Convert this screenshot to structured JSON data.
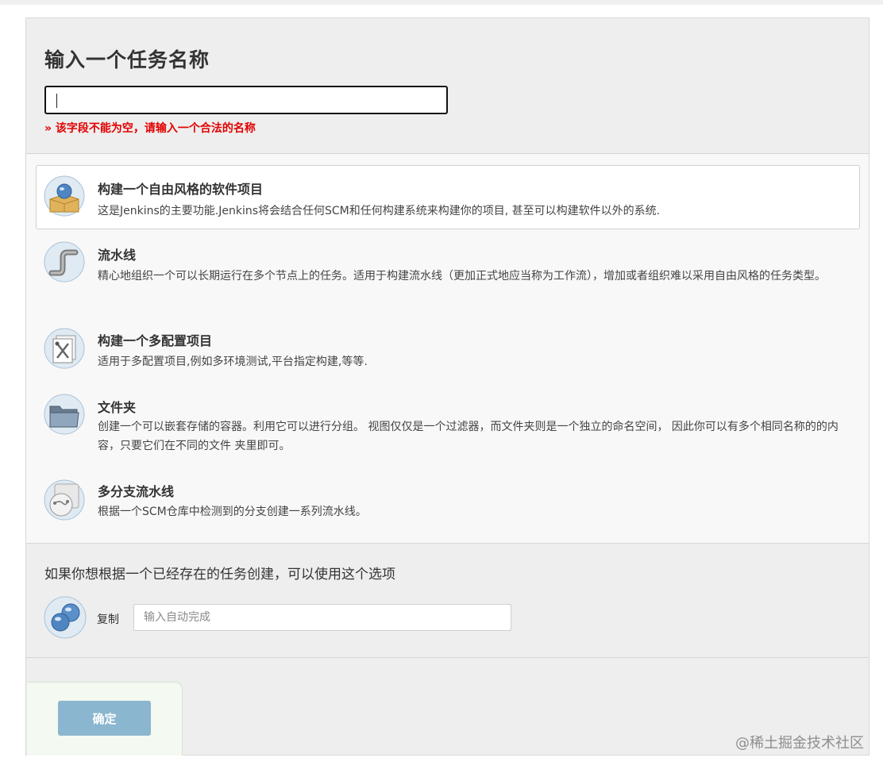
{
  "form": {
    "heading": "输入一个任务名称",
    "name_value": "",
    "error": "» 该字段不能为空，请输入一个合法的名称"
  },
  "types": [
    {
      "icon": "freestyle-project-icon",
      "title": "构建一个自由风格的软件项目",
      "description": "这是Jenkins的主要功能.Jenkins将会结合任何SCM和任何构建系统来构建你的项目, 甚至可以构建软件以外的系统.",
      "selected": true
    },
    {
      "icon": "pipeline-icon",
      "title": "流水线",
      "description": "精心地组织一个可以长期运行在多个节点上的任务。适用于构建流水线（更加正式地应当称为工作流），增加或者组织难以采用自由风格的任务类型。",
      "selected": false
    },
    {
      "icon": "multi-config-project-icon",
      "title": "构建一个多配置项目",
      "description": "适用于多配置项目,例如多环境测试,平台指定构建,等等.",
      "selected": false
    },
    {
      "icon": "folder-icon",
      "title": "文件夹",
      "description": "创建一个可以嵌套存储的容器。利用它可以进行分组。 视图仅仅是一个过滤器，而文件夹则是一个独立的命名空间， 因此你可以有多个相同名称的的内容，只要它们在不同的文件 夹里即可。",
      "selected": false
    },
    {
      "icon": "multibranch-pipeline-icon",
      "title": "多分支流水线",
      "description": "根据一个SCM仓库中检测到的分支创建一系列流水线。",
      "selected": false
    }
  ],
  "copy": {
    "heading": "如果你想根据一个已经存在的任务创建，可以使用这个选项",
    "label": "复制",
    "placeholder": "输入自动完成",
    "icon": "copy-job-icon"
  },
  "actions": {
    "ok_label": "确定"
  },
  "watermark": "@稀土掘金技术社区",
  "colors": {
    "error": "#e30000",
    "ok_button": "#8bb6cf",
    "panel_bg": "#eeeeee"
  }
}
